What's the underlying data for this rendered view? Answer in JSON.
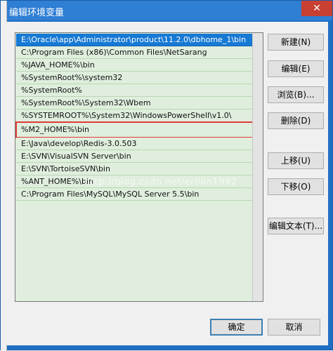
{
  "window": {
    "title": "编辑环境变量",
    "close_label": "✕"
  },
  "list": {
    "items": [
      {
        "text": "E:\\Oracle\\app\\Administrator\\product\\11.2.0\\dbhome_1\\bin",
        "selected": true
      },
      {
        "text": "C:\\Program Files (x86)\\Common Files\\NetSarang"
      },
      {
        "text": "%JAVA_HOME%\\bin"
      },
      {
        "text": "%SystemRoot%\\system32"
      },
      {
        "text": "%SystemRoot%"
      },
      {
        "text": "%SystemRoot%\\System32\\Wbem"
      },
      {
        "text": "%SYSTEMROOT%\\System32\\WindowsPowerShell\\v1.0\\"
      },
      {
        "text": "%M2_HOME%\\bin",
        "highlight": true
      },
      {
        "text": "E:\\Java\\develop\\Redis-3.0.503"
      },
      {
        "text": "E:\\SVN\\VisualSVN Server\\bin"
      },
      {
        "text": "E:\\SVN\\TortoiseSVN\\bin"
      },
      {
        "text": "%ANT_HOME%\\bin"
      },
      {
        "text": "C:\\Program Files\\MySQL\\MySQL Server 5.5\\bin"
      }
    ],
    "watermark": "http://blog.csdn.net/erlian1992"
  },
  "buttons": {
    "new": "新建(N)",
    "edit": "编辑(E)",
    "browse": "浏览(B)...",
    "delete": "删除(D)",
    "move_up": "上移(U)",
    "move_down": "下移(O)",
    "edit_text": "编辑文本(T)...",
    "ok": "确定",
    "cancel": "取消"
  }
}
